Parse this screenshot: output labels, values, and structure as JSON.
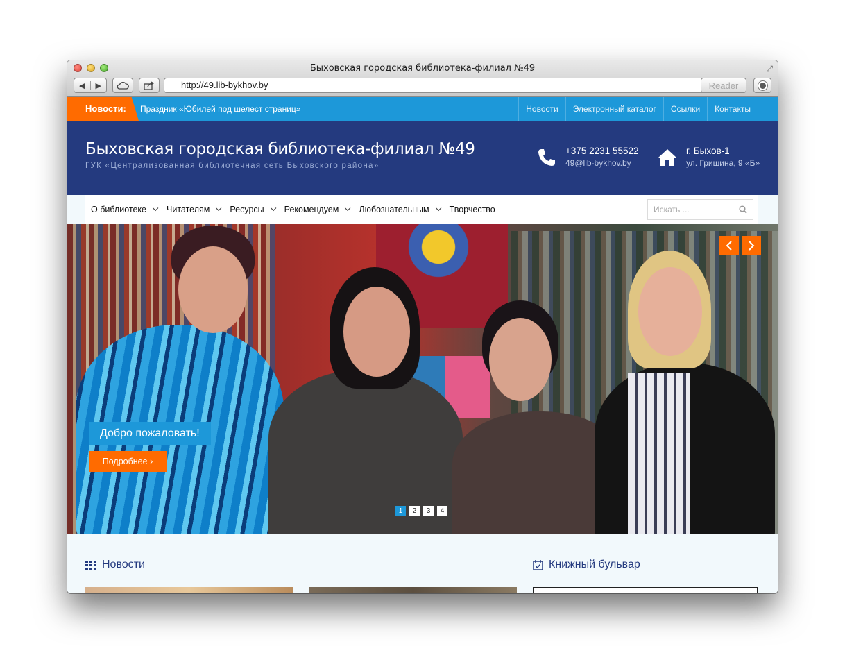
{
  "browser": {
    "window_title": "Быховская городская библиотека-филиал №49",
    "url": "http://49.lib-bykhov.by",
    "reader_label": "Reader"
  },
  "topbar": {
    "news_label": "Новости:",
    "ticker_text": "Праздник «Юбилей под шелест страниц»",
    "links": [
      "Новости",
      "Электронный каталог",
      "Ссылки",
      "Контакты"
    ]
  },
  "header": {
    "title": "Быховская городская библиотека-филиал №49",
    "subtitle": "ГУК «Централизованная библиотечная сеть Быховского района»",
    "phone": "+375 2231 55522",
    "email": "49@lib-bykhov.by",
    "city": "г. Быхов-1",
    "street": "ул. Гришина, 9 «Б»"
  },
  "menu": {
    "items": [
      {
        "label": "О библиотеке",
        "has_dropdown": true
      },
      {
        "label": "Читателям",
        "has_dropdown": true
      },
      {
        "label": "Ресурсы",
        "has_dropdown": true
      },
      {
        "label": "Рекомендуем",
        "has_dropdown": true
      },
      {
        "label": "Любознательным",
        "has_dropdown": true
      },
      {
        "label": "Творчество",
        "has_dropdown": false
      }
    ],
    "search_placeholder": "Искать ..."
  },
  "hero": {
    "caption": "Добро пожаловать!",
    "button_label": "Подробнее ›",
    "pages": [
      "1",
      "2",
      "3",
      "4"
    ],
    "active_page": "1"
  },
  "sections": {
    "news_title": "Новости",
    "books_title": "Книжный бульвар"
  },
  "colors": {
    "accent_orange": "#ff6b00",
    "topbar_blue": "#1d98d9",
    "header_navy": "#243a7f"
  }
}
